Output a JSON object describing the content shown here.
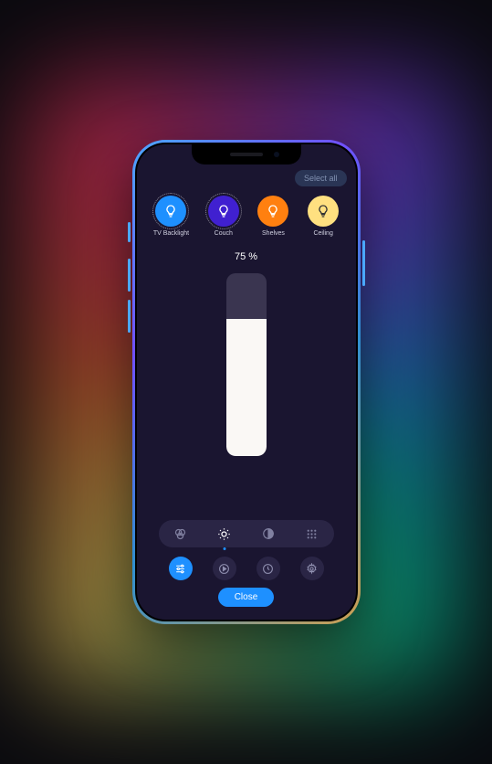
{
  "header": {
    "select_all_label": "Select all"
  },
  "lights": [
    {
      "label": "TV Backlight",
      "color": "#1e90ff",
      "selected": true
    },
    {
      "label": "Couch",
      "color": "#4020d0",
      "selected": true
    },
    {
      "label": "Shelves",
      "color": "#ff8010",
      "selected": false
    },
    {
      "label": "Ceiling",
      "color": "#ffe080",
      "selected": false
    }
  ],
  "brightness": {
    "percent_label": "75 %",
    "percent_value": 75
  },
  "modes": [
    {
      "name": "color",
      "active": false
    },
    {
      "name": "brightness",
      "active": true
    },
    {
      "name": "contrast",
      "active": false
    },
    {
      "name": "grid",
      "active": false
    }
  ],
  "actions": [
    {
      "name": "sliders",
      "primary": true
    },
    {
      "name": "play",
      "primary": false
    },
    {
      "name": "clock",
      "primary": false
    },
    {
      "name": "gear",
      "primary": false
    }
  ],
  "footer": {
    "close_label": "Close"
  },
  "colors": {
    "accent": "#1e90ff"
  }
}
